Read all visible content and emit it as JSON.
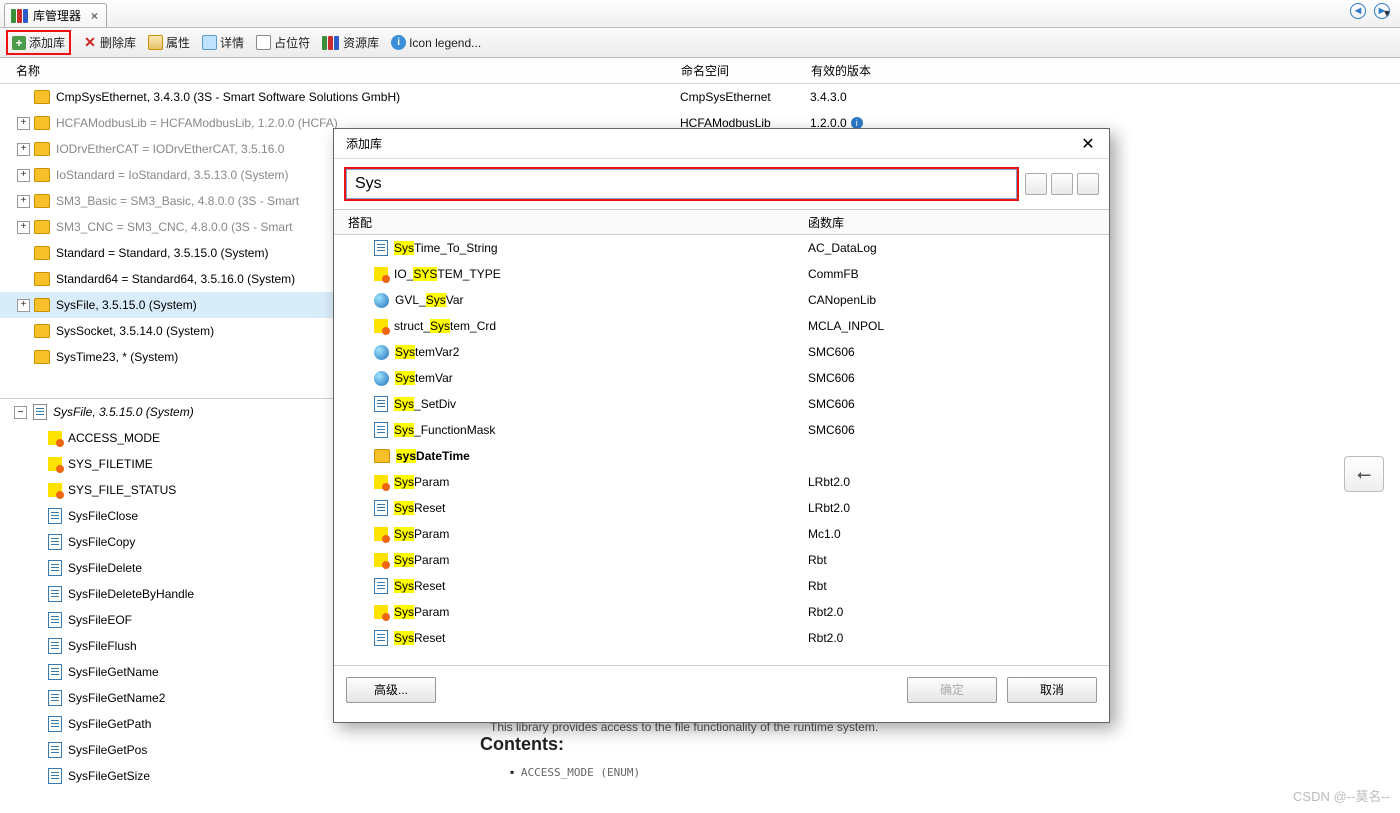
{
  "tab": {
    "title": "库管理器"
  },
  "toolbar": {
    "add": "添加库",
    "delete": "删除库",
    "props": "属性",
    "details": "详情",
    "placeholder": "占位符",
    "resource": "资源库",
    "iconLegend": "Icon legend..."
  },
  "columns": {
    "name": "名称",
    "namespace": "命名空间",
    "version": "有效的版本"
  },
  "tree": [
    {
      "exp": "",
      "label": "CmpSysEthernet, 3.4.3.0 (3S - Smart Software Solutions GmbH)",
      "ns": "CmpSysEthernet",
      "ver": "3.4.3.0"
    },
    {
      "exp": "+",
      "label": "HCFAModbusLib = HCFAModbusLib, 1.2.0.0 (HCFA)",
      "gray": true,
      "ns": "HCFAModbusLib",
      "ver": "1.2.0.0",
      "info": true
    },
    {
      "exp": "+",
      "label": "IODrvEtherCAT = IODrvEtherCAT, 3.5.16.0",
      "gray": true
    },
    {
      "exp": "+",
      "label": "IoStandard = IoStandard, 3.5.13.0 (System)",
      "gray": true
    },
    {
      "exp": "+",
      "label": "SM3_Basic = SM3_Basic, 4.8.0.0 (3S - Smart",
      "gray": true
    },
    {
      "exp": "+",
      "label": "SM3_CNC = SM3_CNC, 4.8.0.0 (3S - Smart",
      "gray": true
    },
    {
      "exp": "",
      "label": "Standard = Standard, 3.5.15.0 (System)"
    },
    {
      "exp": "",
      "label": "Standard64 = Standard64, 3.5.16.0 (System)"
    },
    {
      "exp": "+",
      "label": "SysFile, 3.5.15.0 (System)",
      "sel": true
    },
    {
      "exp": "",
      "label": "SysSocket, 3.5.14.0 (System)"
    },
    {
      "exp": "",
      "label": "SysTime23, * (System)"
    }
  ],
  "lower": {
    "root": "SysFile, 3.5.15.0 (System)",
    "items": [
      {
        "icon": "struct",
        "label": "ACCESS_MODE"
      },
      {
        "icon": "struct",
        "label": "SYS_FILETIME"
      },
      {
        "icon": "struct",
        "label": "SYS_FILE_STATUS"
      },
      {
        "icon": "doc",
        "label": "SysFileClose"
      },
      {
        "icon": "doc",
        "label": "SysFileCopy"
      },
      {
        "icon": "doc",
        "label": "SysFileDelete"
      },
      {
        "icon": "doc",
        "label": "SysFileDeleteByHandle"
      },
      {
        "icon": "doc",
        "label": "SysFileEOF"
      },
      {
        "icon": "doc",
        "label": "SysFileFlush"
      },
      {
        "icon": "doc",
        "label": "SysFileGetName"
      },
      {
        "icon": "doc",
        "label": "SysFileGetName2"
      },
      {
        "icon": "doc",
        "label": "SysFileGetPath"
      },
      {
        "icon": "doc",
        "label": "SysFileGetPos"
      },
      {
        "icon": "doc",
        "label": "SysFileGetSize"
      }
    ]
  },
  "modal": {
    "title": "添加库",
    "search": "Sys",
    "cols": {
      "match": "搭配",
      "lib": "函数库"
    },
    "rows": [
      {
        "icon": "doc",
        "pre": "",
        "hl": "Sys",
        "post": "Time_To_String",
        "lib": "AC_DataLog"
      },
      {
        "icon": "struct",
        "pre": "IO_",
        "hl": "SYS",
        "post": "TEM_TYPE",
        "lib": "CommFB"
      },
      {
        "icon": "globe",
        "pre": "GVL_",
        "hl": "Sys",
        "post": "Var",
        "lib": "CANopenLib"
      },
      {
        "icon": "struct",
        "pre": "struct_",
        "hl": "Sys",
        "post": "tem_Crd",
        "lib": "MCLA_INPOL"
      },
      {
        "icon": "globe",
        "pre": "",
        "hl": "Sys",
        "post": "temVar2",
        "lib": "SMC606"
      },
      {
        "icon": "globe",
        "pre": "",
        "hl": "Sys",
        "post": "temVar",
        "lib": "SMC606"
      },
      {
        "icon": "doc",
        "pre": "",
        "hl": "Sys",
        "post": "_SetDiv",
        "lib": "SMC606"
      },
      {
        "icon": "doc",
        "pre": "",
        "hl": "Sys",
        "post": "_FunctionMask",
        "lib": "SMC606"
      },
      {
        "icon": "folder",
        "pre": "",
        "hl": "sys",
        "post": "DateTime",
        "lib": "",
        "bold": true
      },
      {
        "icon": "struct",
        "pre": "",
        "hl": "Sys",
        "post": "Param",
        "lib": "LRbt2.0"
      },
      {
        "icon": "doc",
        "pre": "",
        "hl": "Sys",
        "post": "Reset",
        "lib": "LRbt2.0"
      },
      {
        "icon": "struct",
        "pre": "",
        "hl": "Sys",
        "post": "Param",
        "lib": "Mc1.0"
      },
      {
        "icon": "struct",
        "pre": "",
        "hl": "Sys",
        "post": "Param",
        "lib": "Rbt"
      },
      {
        "icon": "doc",
        "pre": "",
        "hl": "Sys",
        "post": "Reset",
        "lib": "Rbt"
      },
      {
        "icon": "struct",
        "pre": "",
        "hl": "Sys",
        "post": "Param",
        "lib": "Rbt2.0"
      },
      {
        "icon": "doc",
        "pre": "",
        "hl": "Sys",
        "post": "Reset",
        "lib": "Rbt2.0"
      }
    ],
    "advanced": "高级...",
    "ok": "确定",
    "cancel": "取消"
  },
  "doc": {
    "line": "This library provides access to the file functionality of the runtime system.",
    "contents": "Contents:",
    "item": "ACCESS_MODE (ENUM)"
  },
  "watermark": "CSDN @--莫名--"
}
